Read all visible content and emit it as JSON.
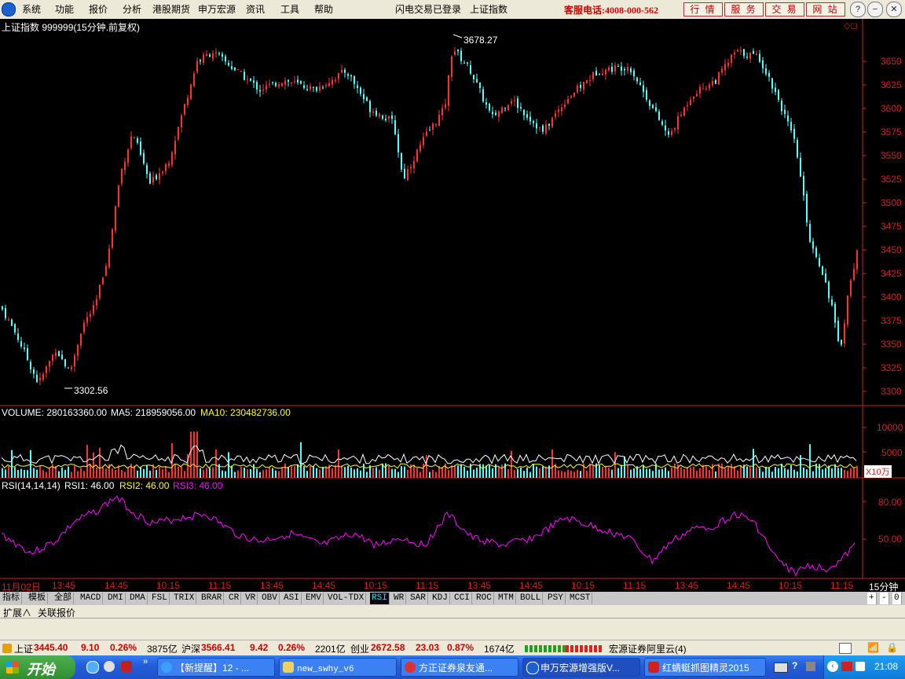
{
  "menu": {
    "logo_icon": "app-logo-icon",
    "items": [
      "系统",
      "功能",
      "报价",
      "分析",
      "港股期货",
      "申万宏源",
      "资讯",
      "工具",
      "帮助"
    ],
    "login_status": "闪电交易已登录",
    "index_name": "上证指数",
    "hotline": "客服电话:4008-000-562",
    "buttons": [
      "行 情",
      "服 务",
      "交 易",
      "网 站"
    ],
    "window_controls": [
      "?",
      "−",
      "❐",
      "✕"
    ]
  },
  "chart": {
    "title": "上证指数 999999(15分钟.前复权)",
    "high_label": "3678.27",
    "low_label": "3302.56",
    "price_ticks": [
      "3650",
      "3625",
      "3600",
      "3575",
      "3550",
      "3525",
      "3500",
      "3475",
      "3450",
      "3425",
      "3400",
      "3375",
      "3350",
      "3325",
      "3300"
    ],
    "volume_header": {
      "volume": "VOLUME: 280163360.00",
      "ma5": "MA5: 218959056.00",
      "ma10": "MA10: 230482736.00"
    },
    "volume_ticks": [
      "10000",
      "5000"
    ],
    "volume_unit": "X10万",
    "rsi_header": {
      "name": "RSI(14,14,14)",
      "rsi1": "RSI1: 46.00",
      "rsi2": "RSI2: 46.00",
      "rsi3": "RSI3: 46.00"
    },
    "rsi_ticks": [
      "80.00",
      "50.00"
    ],
    "time_axis": [
      "11月02日",
      "13:45",
      "14:45",
      "10:15",
      "11:15",
      "13:45",
      "14:45",
      "10:15",
      "11:15",
      "13:45",
      "14:45",
      "10:15",
      "11:15",
      "13:45",
      "14:45",
      "10:15",
      "11:15"
    ],
    "period": "15分钟",
    "colors": {
      "up": "#ff3232",
      "down": "#54ffff",
      "ma5": "#ffffff",
      "ma10": "#ffff00",
      "rsi": "#ff00ff",
      "axis": "#cc2222"
    }
  },
  "indicator_tabs": [
    "指标",
    "模板",
    "全部",
    "MACD",
    "DMI",
    "DMA",
    "FSL",
    "TRIX",
    "BRAR",
    "CR",
    "VR",
    "OBV",
    "ASI",
    "EMV",
    "VOL-TDX",
    "RSI",
    "WR",
    "SAR",
    "KDJ",
    "CCI",
    "ROC",
    "MTM",
    "BOLL",
    "PSY",
    "MCST"
  ],
  "active_tab": "RSI",
  "tab_controls": [
    "+",
    "-",
    "0"
  ],
  "extension": [
    "扩展∧",
    "关联报价"
  ],
  "status": {
    "sh_name": "上证",
    "sh_value": "3445.40",
    "sh_change": "9.10",
    "sh_pct": "0.26%",
    "sh_amount": "3875亿",
    "hs_name": "沪深",
    "hs_value": "3566.41",
    "hs_change": "9.42",
    "hs_pct": "0.26%",
    "hs_amount": "2201亿",
    "cy_name": "创业",
    "cy_value": "2672.58",
    "cy_change": "23.03",
    "cy_pct": "0.87%",
    "cy_amount": "1674亿",
    "server": "宏源证券阿里云(4)"
  },
  "taskbar": {
    "start": "开始",
    "tasks": [
      "【新提醒】12 - ...",
      "new_swhy_v6",
      "方正证券泉友通...",
      "申万宏源增强版V...",
      "红蜻蜓抓图精灵2015"
    ],
    "clock": "21:08"
  }
}
